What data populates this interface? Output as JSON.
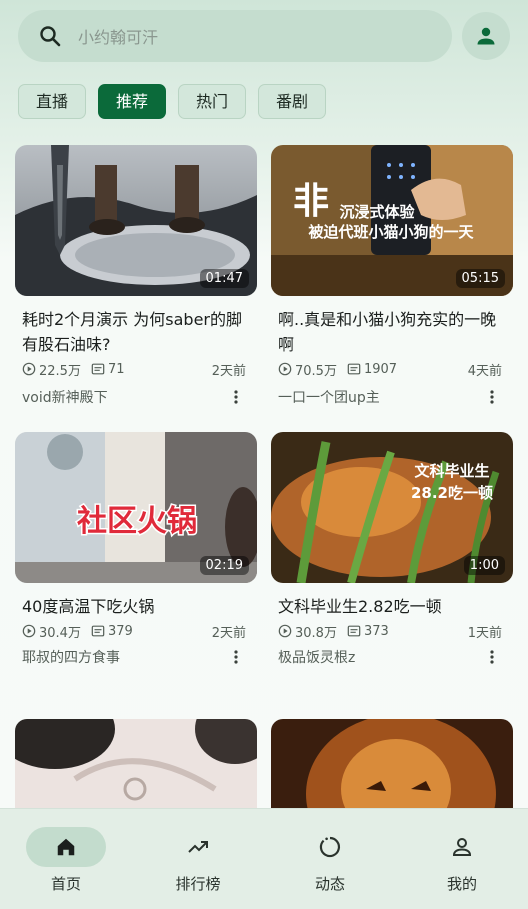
{
  "search": {
    "placeholder": "小约翰可汗"
  },
  "chips": [
    "直播",
    "推荐",
    "热门",
    "番剧"
  ],
  "active_chip": "推荐",
  "videos": [
    {
      "duration": "01:47",
      "title": "耗时2个月演示 为何saber的脚有股石油味?",
      "views": "22.5万",
      "comments": "71",
      "time": "2天前",
      "author": "void新神殿下",
      "thumb_text": ""
    },
    {
      "duration": "05:15",
      "title": "啊..真是和小猫小狗充实的一晚啊",
      "views": "70.5万",
      "comments": "1907",
      "time": "4天前",
      "author": "一口一个团up主",
      "thumb_text_big": "非",
      "thumb_text_1": "沉浸式体验",
      "thumb_text_2": "被迫代班小猫小狗的一天"
    },
    {
      "duration": "02:19",
      "title": "40度高温下吃火锅",
      "views": "30.4万",
      "comments": "379",
      "time": "2天前",
      "author": "耶叔的四方食事",
      "thumb_text": "社区火锅"
    },
    {
      "duration": "1:00",
      "title": "文科毕业生2.82吃一顿",
      "views": "30.8万",
      "comments": "373",
      "time": "1天前",
      "author": "极品饭灵根z",
      "thumb_text_1": "文科毕业生",
      "thumb_text_2": "28.2吃一顿"
    }
  ],
  "nav": [
    {
      "label": "首页",
      "icon": "home-icon",
      "active": true
    },
    {
      "label": "排行榜",
      "icon": "trending-icon",
      "active": false
    },
    {
      "label": "动态",
      "icon": "dynamic-icon",
      "active": false
    },
    {
      "label": "我的",
      "icon": "profile-icon",
      "active": false
    }
  ],
  "colors": {
    "accent": "#0b6a3a",
    "chip_bg": "#d3e7db",
    "nav_active": "#c3dccd"
  }
}
